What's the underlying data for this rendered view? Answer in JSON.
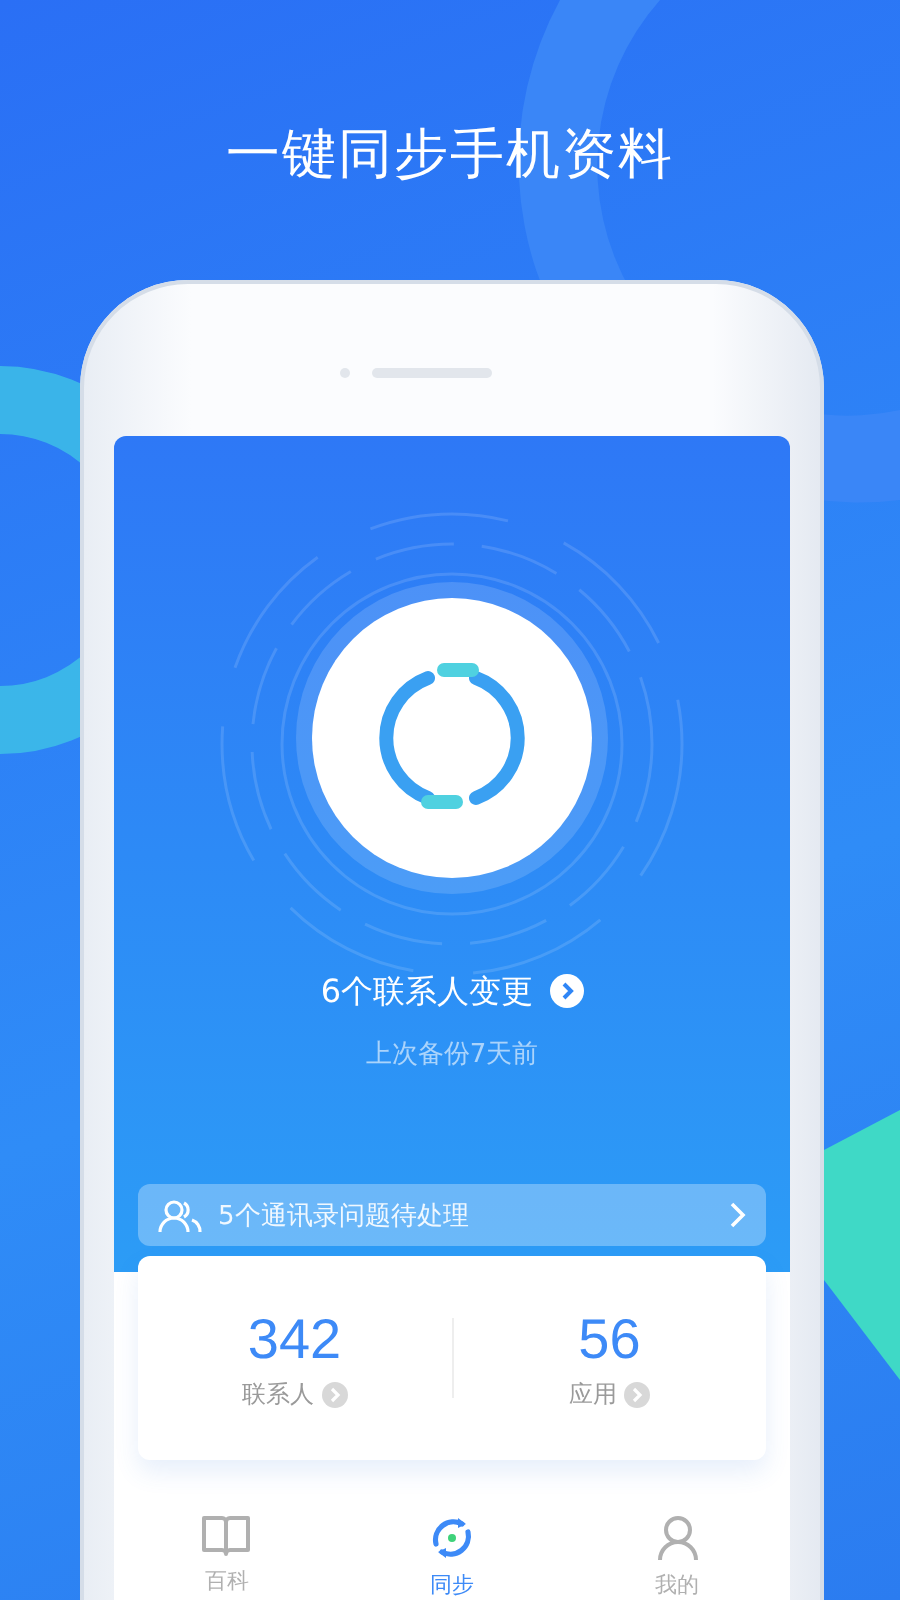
{
  "headline": "一键同步手机资料",
  "sync": {
    "changes": "6个联系人变更",
    "last_backup": "上次备份7天前"
  },
  "notice": {
    "text": "5个通讯录问题待处理"
  },
  "stats": [
    {
      "value": "342",
      "label": "联系人"
    },
    {
      "value": "56",
      "label": "应用"
    }
  ],
  "tabs": [
    {
      "label": "百科",
      "kind": "book",
      "selected": false
    },
    {
      "label": "同步",
      "kind": "sync",
      "selected": true
    },
    {
      "label": "我的",
      "kind": "person",
      "selected": false
    }
  ]
}
